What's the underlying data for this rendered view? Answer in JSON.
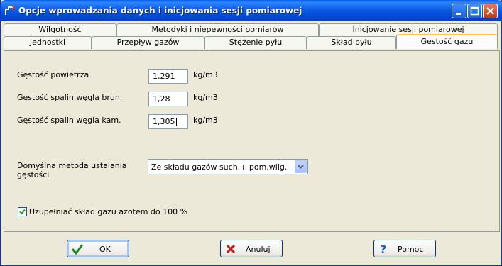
{
  "window": {
    "title": "Opcje wprowadzania danych i inicjowania sesji pomiarowej",
    "controls": [
      "minimize-icon",
      "maximize-icon",
      "close-icon"
    ]
  },
  "tabs": {
    "row1": [
      "Wilgotność",
      "Metodyki i niepewności pomiarów",
      "Inicjowanie sesji pomiarowej"
    ],
    "row2": [
      "Jednostki",
      "Przepływ gazów",
      "Stężenie pyłu",
      "Skład pyłu",
      "Gęstość gazu"
    ],
    "active": "Gęstość gazu"
  },
  "fields": [
    {
      "label": "Gęstość powietrza",
      "value": "1,291",
      "unit": "kg/m3"
    },
    {
      "label": "Gęstość spalin węgla brun.",
      "value": "1,28",
      "unit": "kg/m3"
    },
    {
      "label": "Gęstość spalin węgla kam.",
      "value": "1,305",
      "unit": "kg/m3"
    }
  ],
  "method": {
    "label_line1": "Domyślna metoda ustalania",
    "label_line2": "gęstości",
    "selected": "Ze składu gazów such.+ pom.wilg."
  },
  "checkbox": {
    "label": "Uzupełniać skład gazu azotem do 100 %",
    "checked": true
  },
  "buttons": {
    "ok": "OK",
    "cancel": "Anuluj",
    "help": "Pomoc"
  },
  "colors": {
    "titlebar": "#0a5eec",
    "face": "#ece9d8",
    "active_tab_accent": "#ffc83c"
  }
}
